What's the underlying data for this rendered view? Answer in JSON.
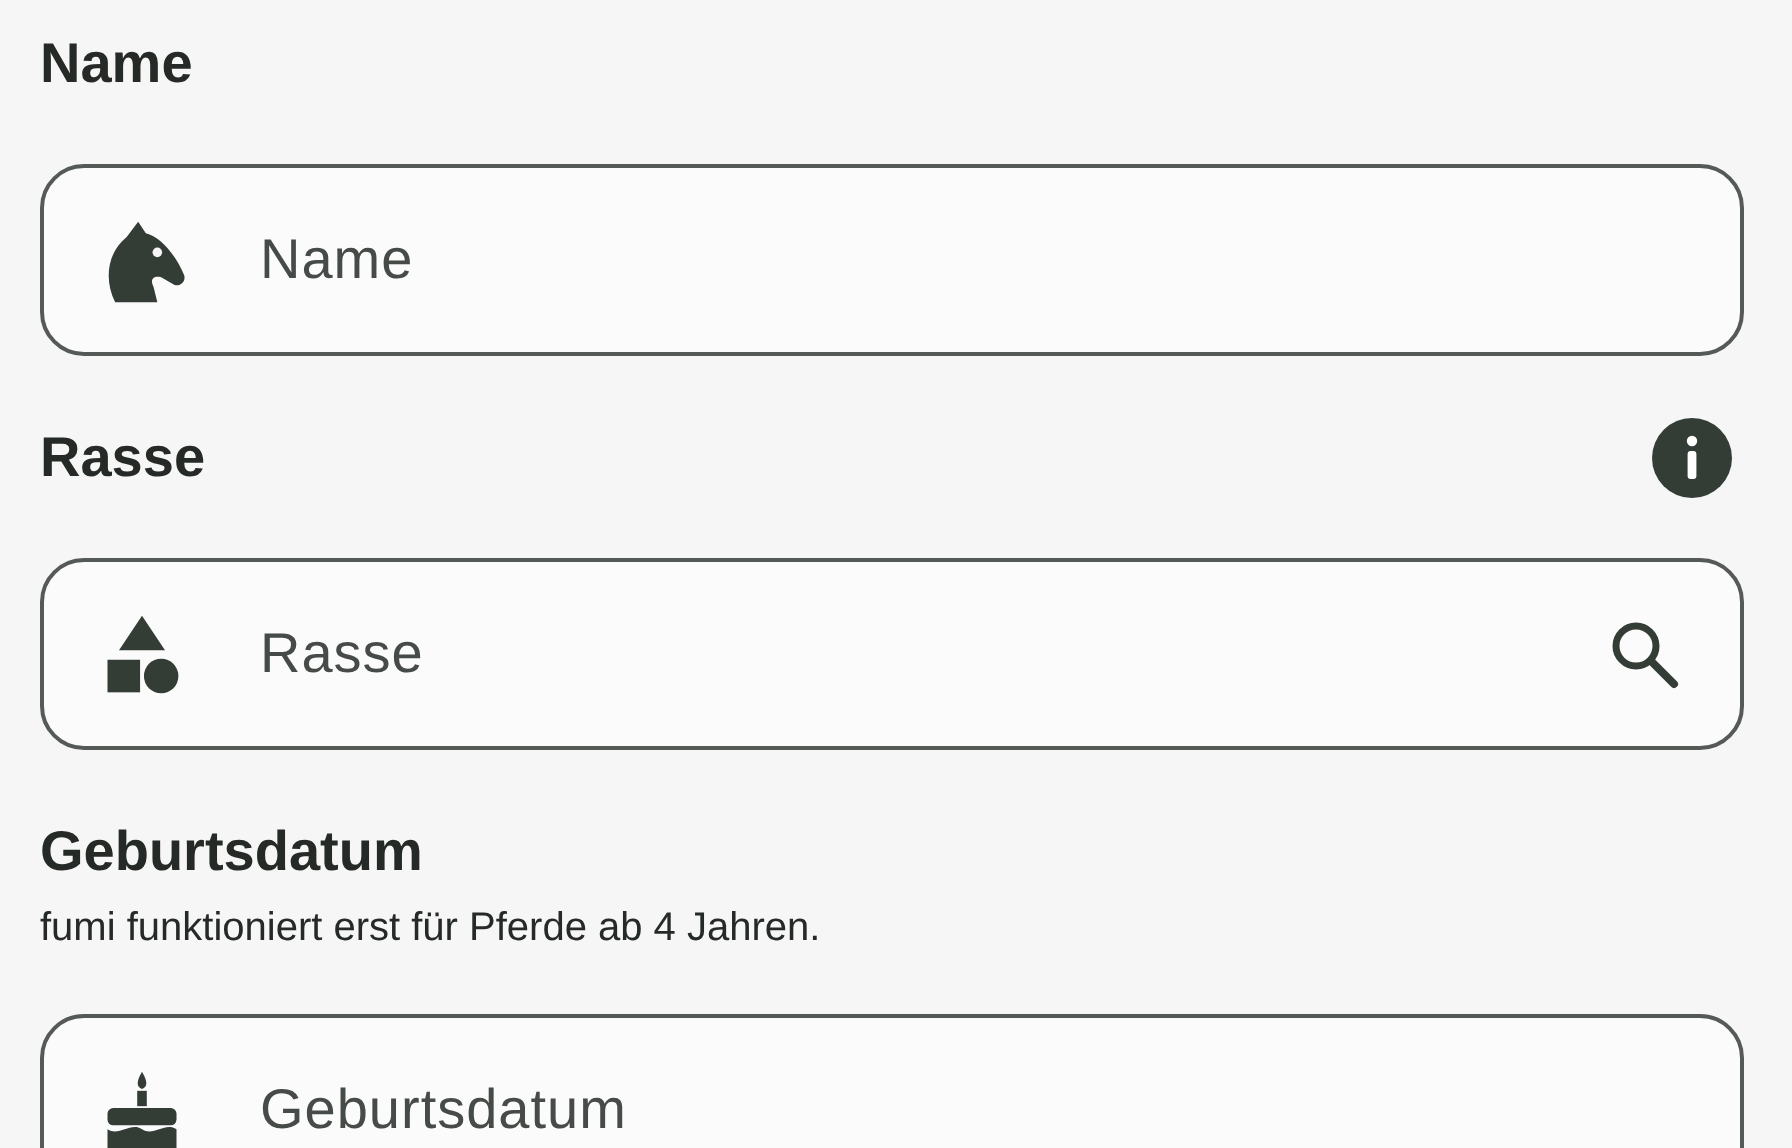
{
  "fields": [
    {
      "kind": "name",
      "label": "Name",
      "placeholder": "Name",
      "info_button": false,
      "search_button": false
    },
    {
      "kind": "breed",
      "label": "Rasse",
      "placeholder": "Rasse",
      "info_button": true,
      "search_button": true
    },
    {
      "kind": "date",
      "label": "Geburtsdatum",
      "hint": "fumi funktioniert erst für Pferde ab 4 Jahren.",
      "placeholder": "Geburtsdatum",
      "info_button": false,
      "search_button": false
    }
  ]
}
